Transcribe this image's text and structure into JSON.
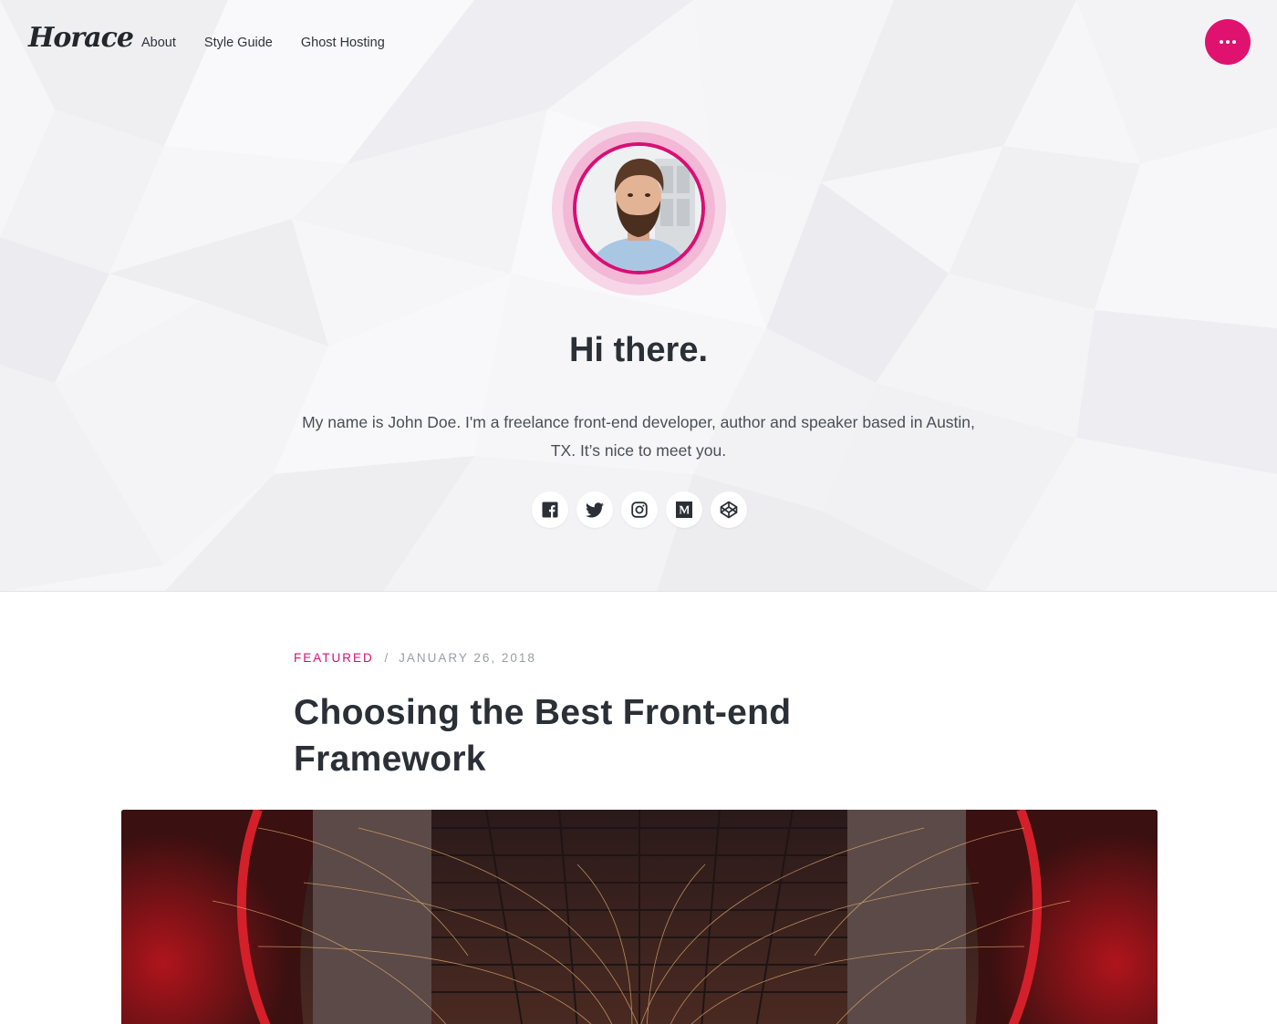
{
  "header": {
    "logo_text": "Horace",
    "nav": [
      {
        "label": "About"
      },
      {
        "label": "Style Guide"
      },
      {
        "label": "Ghost Hosting"
      }
    ],
    "menu_icon": "more-dots-icon"
  },
  "hero": {
    "title": "Hi there.",
    "bio": "My name is John Doe. I'm a freelance front-end developer, author and speaker based in Austin, TX. It’s nice to meet you.",
    "social_icons": [
      "facebook-icon",
      "twitter-icon",
      "instagram-icon",
      "medium-icon",
      "codepen-icon"
    ]
  },
  "post": {
    "tag": "FEATURED",
    "separator": "/",
    "date": "JANUARY 26, 2018",
    "title": "Choosing the Best Front-end Framework"
  },
  "colors": {
    "accent": "#e0126f",
    "text": "#2b2f36",
    "hero_bg": "#f6f6f8"
  }
}
